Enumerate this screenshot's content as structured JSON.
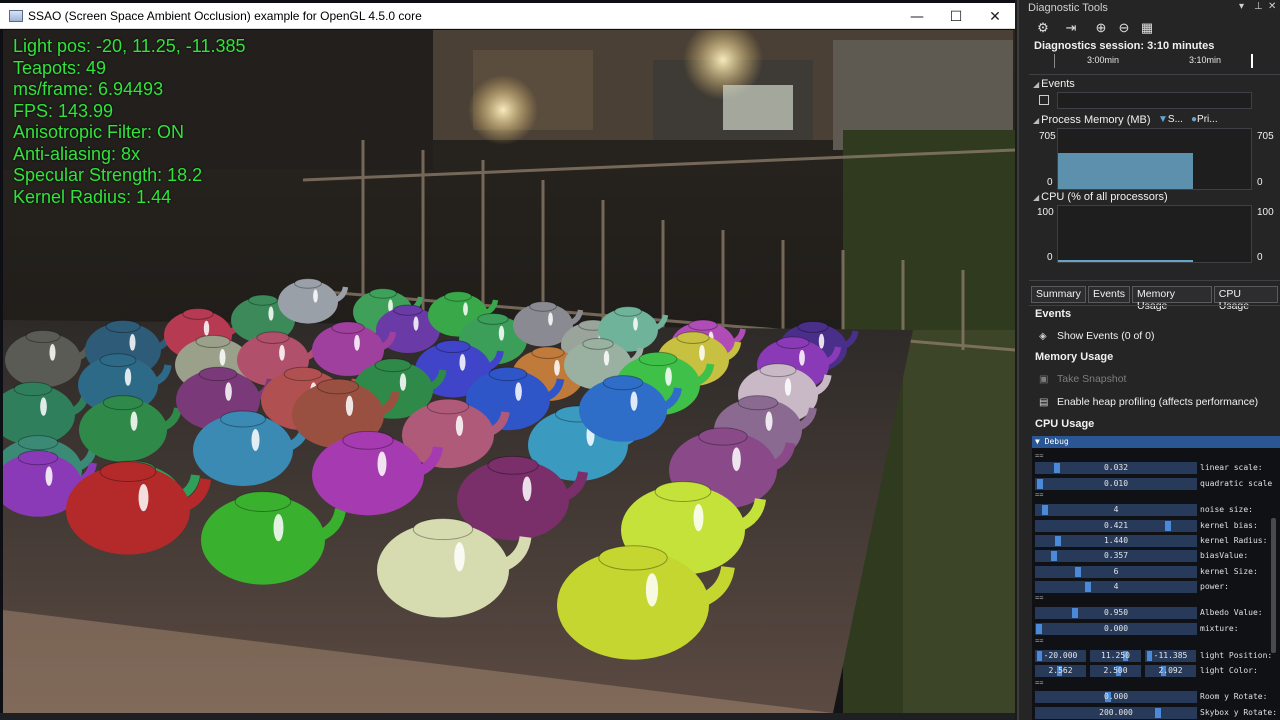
{
  "gl_window": {
    "title": "SSAO (Screen Space Ambient Occlusion) example for OpenGL 4.5.0 core",
    "overlay": [
      "Light pos: -20, 11.25, -11.385",
      "Teapots: 49",
      "ms/frame: 6.94493",
      "FPS: 143.99",
      "Anisotropic Filter: ON",
      "Anti-aliasing: 8x",
      "Specular Strength: 18.2",
      "Kernel Radius: 1.44"
    ],
    "controls": {
      "minimize": "—",
      "maximize": "☐",
      "close": "✕"
    }
  },
  "diagnostics": {
    "title": "Diagnostic Tools",
    "session": "Diagnostics session: 3:10 minutes",
    "timeline_labels": [
      "3:00min",
      "3:10min"
    ],
    "events_header": "Events",
    "memory_header": "Process Memory (MB)",
    "legend_s": "S...",
    "legend_p": "Pri...",
    "memory_max": "705",
    "memory_min": "0",
    "memory_level_pct": 60,
    "cpu_header": "CPU (% of all processors)",
    "cpu_max": "100",
    "cpu_min": "0",
    "tabs": [
      "Summary",
      "Events",
      "Memory Usage",
      "CPU Usage"
    ],
    "events_panel": {
      "header": "Events",
      "show_events": "Show Events (0 of 0)"
    },
    "memory_panel": {
      "header": "Memory Usage",
      "take_snapshot": "Take Snapshot",
      "heap_profiling": "Enable heap profiling (affects performance)"
    },
    "cpu_panel": {
      "header": "CPU Usage"
    },
    "colors": {
      "accent": "#2a5793",
      "memory_fill": "#69a4c7",
      "overlay_text": "#31e33b"
    }
  },
  "debug_panel": {
    "title": "Debug",
    "sliders": [
      {
        "value": "0.032",
        "label": "linear scale:"
      },
      {
        "value": "0.010",
        "label": "quadratic scale"
      },
      {
        "value": "4",
        "label": "noise size:"
      },
      {
        "value": "0.421",
        "label": "kernel bias:"
      },
      {
        "value": "1.440",
        "label": "kernel Radius:"
      },
      {
        "value": "0.357",
        "label": "biasValue:"
      },
      {
        "value": "6",
        "label": "kernel Size:"
      },
      {
        "value": "4",
        "label": "power:"
      },
      {
        "value": "0.950",
        "label": "Albedo Value:"
      },
      {
        "value": "0.000",
        "label": "mixture:"
      }
    ],
    "light_position": {
      "label": "light Position:",
      "values": [
        "-20.000",
        "11.250",
        "-11.385"
      ]
    },
    "light_color": {
      "label": "light Color:",
      "values": [
        "2.562",
        "2.500",
        "2.092"
      ]
    },
    "room_rotate": {
      "value": "0.000",
      "label": "Room y Rotate:"
    },
    "skybox_rotate": {
      "value": "200.000",
      "label": "Skybox y Rotate:"
    }
  }
}
